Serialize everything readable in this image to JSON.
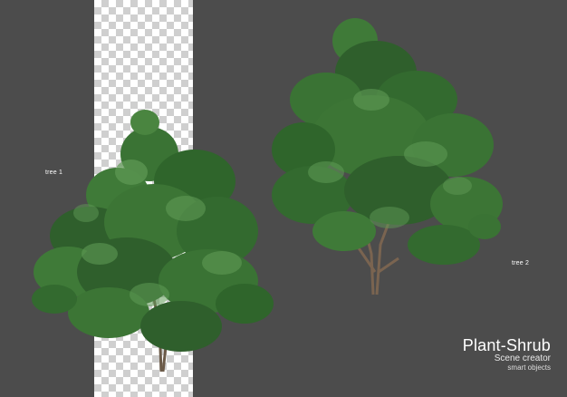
{
  "labels": {
    "tree1": "tree 1",
    "tree2": "tree 2"
  },
  "brand": {
    "title": "Plant-Shrub",
    "subtitle": "Scene creator",
    "tagline": "smart objects"
  },
  "colors": {
    "background": "#4c4c4c",
    "foliage_dark": "#2f5f2c",
    "foliage_mid": "#3f7a38",
    "foliage_light": "#5f9a55",
    "trunk": "#6b5a48"
  }
}
